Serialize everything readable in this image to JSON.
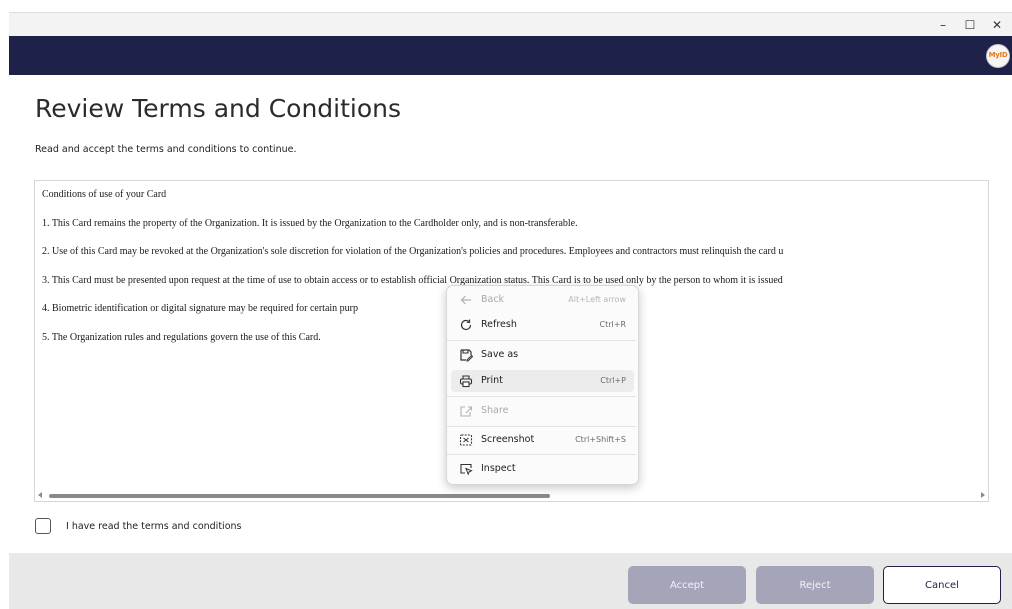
{
  "window": {
    "minimize": "–",
    "maximize": "☐",
    "close": "✕"
  },
  "brand": {
    "logo_text": "MyID",
    "bar_color": "#1e2148",
    "logo_color": "#e27b1f"
  },
  "page": {
    "title": "Review Terms and Conditions",
    "subtitle": "Read and accept the terms and conditions to continue."
  },
  "terms": {
    "heading": "Conditions of use of your Card",
    "lines": [
      "1. This Card remains the property of the Organization. It is issued by the Organization to the Cardholder only, and is non-transferable.",
      "2. Use of this Card may be revoked at the Organization's sole discretion for violation of the Organization's policies and procedures. Employees and contractors must relinquish the card u",
      "3. This Card must be presented upon request at the time of use to obtain access or to establish official Organization status. This Card is to be used only by the person to whom it is issued",
      "4. Biometric identification or digital signature may be required for certain purp",
      "5. The Organization rules and regulations govern the use of this Card."
    ],
    "scroll_position": 0
  },
  "agree": {
    "label": "I have read the terms and conditions",
    "checked": false
  },
  "footer": {
    "accept_label": "Accept",
    "reject_label": "Reject",
    "cancel_label": "Cancel"
  },
  "context_menu": {
    "items": [
      {
        "label": "Back",
        "shortcut": "Alt+Left arrow",
        "icon": "back-arrow-icon",
        "disabled": true
      },
      {
        "label": "Refresh",
        "shortcut": "Ctrl+R",
        "icon": "refresh-icon",
        "disabled": false
      },
      {
        "label": "Save as",
        "shortcut": "",
        "icon": "save-as-icon",
        "disabled": false
      },
      {
        "label": "Print",
        "shortcut": "Ctrl+P",
        "icon": "print-icon",
        "disabled": false,
        "highlighted": true
      },
      {
        "label": "Share",
        "shortcut": "",
        "icon": "share-icon",
        "disabled": true
      },
      {
        "label": "Screenshot",
        "shortcut": "Ctrl+Shift+S",
        "icon": "screenshot-icon",
        "disabled": false
      },
      {
        "label": "Inspect",
        "shortcut": "",
        "icon": "inspect-icon",
        "disabled": false
      }
    ]
  }
}
